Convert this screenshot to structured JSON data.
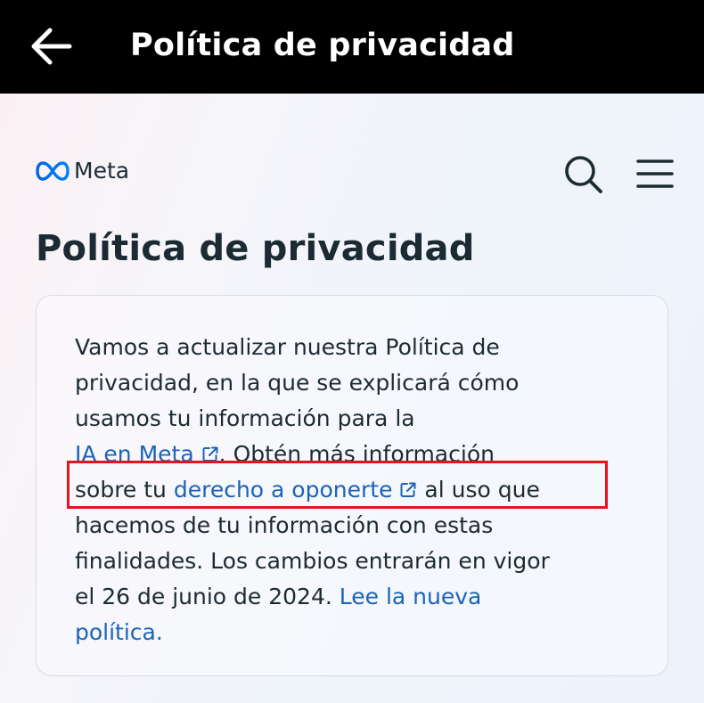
{
  "header": {
    "title": "Política de privacidad"
  },
  "site": {
    "brand": "Meta"
  },
  "page": {
    "title": "Política de privacidad"
  },
  "notice": {
    "line1": "Vamos a actualizar nuestra Política de",
    "line2": "privacidad, en la que se explicará cómo",
    "line3": "usamos tu información para la",
    "link_ai": "IA en Meta",
    "line4_rest": ". Obtén más información",
    "line5_prefix": "sobre tu ",
    "link_object": "derecho a oponerte",
    "line5_suffix": " al uso que",
    "line6": "hacemos de tu información con estas",
    "line7": "finalidades. Los cambios entrarán en vigor",
    "line8_prefix": "el 26 de junio de 2024. ",
    "link_read_part1": "Lee la nueva",
    "link_read_part2": "política."
  },
  "icons": {
    "back": "arrow-left-icon",
    "search": "search-icon",
    "menu": "hamburger-menu-icon",
    "external": "external-link-icon",
    "logo": "meta-infinity-logo"
  },
  "colors": {
    "topbar": "#000000",
    "text": "#1c2b33",
    "link": "#1b63b8",
    "highlight": "#e3141e",
    "meta_blue": "#0668e1"
  }
}
